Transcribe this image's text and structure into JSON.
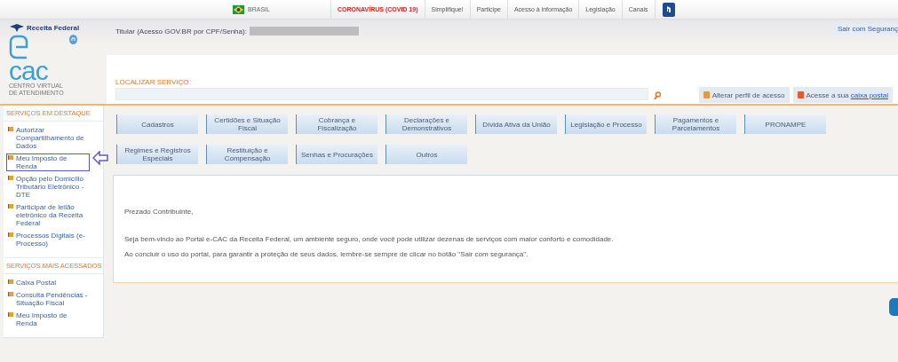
{
  "gov_bar": {
    "country": "BRASIL",
    "links": [
      {
        "label": "CORONAVÍRUS (COVID 19)",
        "kind": "alert"
      },
      {
        "label": "Simplifique!",
        "kind": "normal"
      },
      {
        "label": "Participe",
        "kind": "normal"
      },
      {
        "label": "Acesso à informação",
        "kind": "normal"
      },
      {
        "label": "Legislação",
        "kind": "normal"
      },
      {
        "label": "Canais",
        "kind": "normal"
      }
    ]
  },
  "header": {
    "agency": "Receita Federal",
    "logo_text": "cac",
    "logo_subtitle": "CENTRO VIRTUAL DE ATENDIMENTO",
    "holder_label": "Titular (Acesso GOV.BR por CPF/Senha):",
    "logout": "Sair com Seguranç"
  },
  "search": {
    "label": "LOCALIZAR SERVIÇO"
  },
  "actions": [
    {
      "label": "Alterar perfil de acesso",
      "kind": "plain"
    },
    {
      "label": "Acesse a sua ",
      "link": "caixa postal",
      "kind": "link"
    }
  ],
  "sidebar": [
    {
      "title": "SERVIÇOS EM DESTAQUE",
      "items": [
        {
          "label": "Autorizar Compartilhamento de Dados",
          "selected": false
        },
        {
          "label": "Meu Imposto de Renda",
          "selected": true
        },
        {
          "label": "Opção pelo Domicílio Tributário Eletrônico - DTE",
          "selected": false
        },
        {
          "label": "Participar de leilão eletrônico da Receita Federal",
          "selected": false
        },
        {
          "label": "Processos Digitais (e-Processo)",
          "selected": false
        }
      ]
    },
    {
      "title": "SERVIÇOS MAIS ACESSADOS",
      "items": [
        {
          "label": "Caixa Postal",
          "selected": false
        },
        {
          "label": "Consulta Pendências - Situação Fiscal",
          "selected": false
        },
        {
          "label": "Meu Imposto de Renda",
          "selected": false
        }
      ]
    }
  ],
  "services": [
    [
      "Cadastros",
      "Certidões e Situação Fiscal",
      "Cobrança e Fiscalização",
      "Declarações e Demonstrativos",
      "Dívida Ativa da União",
      "Legislação e Processo",
      "Pagamentos e Parcelamentos",
      "PRONAMPE"
    ],
    [
      "Regimes e Registros Especiais",
      "Restituição e Compensação",
      "Senhas e Procurações",
      "Outros"
    ]
  ],
  "welcome": {
    "greeting": "Prezado Contribuinte,",
    "paragraphs": [
      "Seja bem-vindo ao Portal e-CAC da Receita Federal, um ambiente seguro, onde você pode utilizar dezenas de serviços com maior conforto e comodidade.",
      "Ao concluir o uso do portal, para garantir a proteção de seus dados, lembre-se sempre de clicar no botão \"Sair com segurança\"."
    ]
  }
}
